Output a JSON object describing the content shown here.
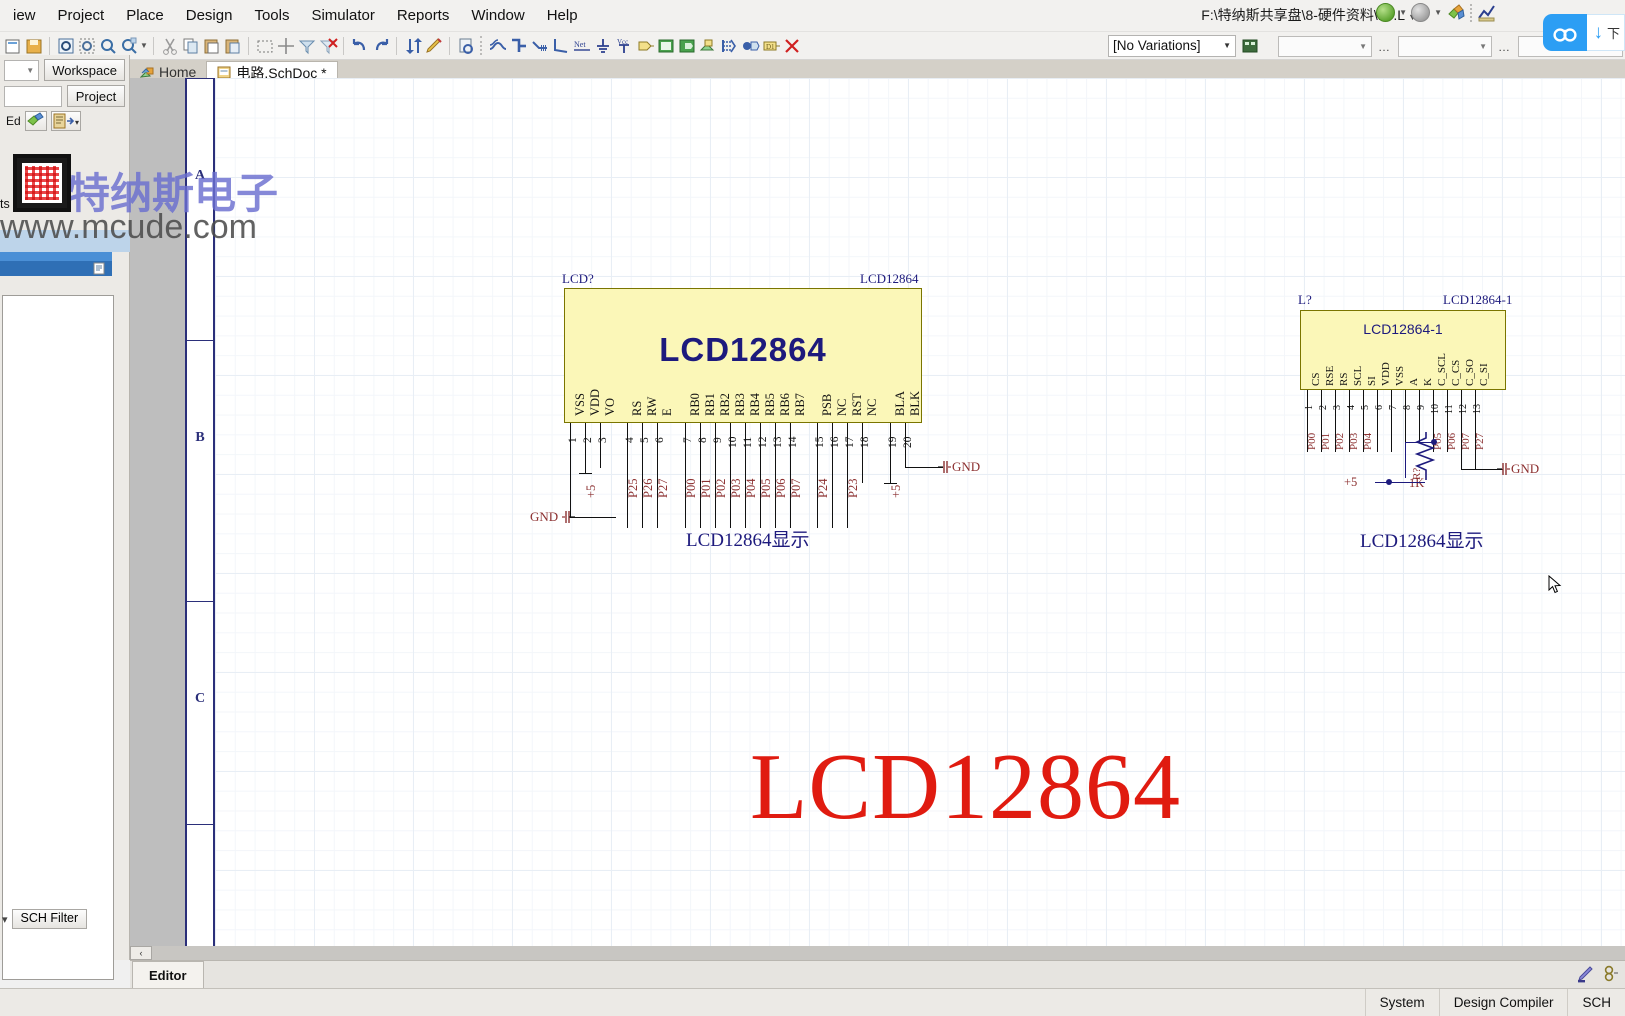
{
  "app": {
    "menu": [
      "iew",
      "Project",
      "Place",
      "Design",
      "Tools",
      "Simulator",
      "Reports",
      "Window",
      "Help"
    ],
    "document_path": "F:\\特纳斯共享盘\\8-硬件资料\\10.L",
    "variations": "[No Variations]"
  },
  "tabs": [
    {
      "label": "Home",
      "icon": "home-icon",
      "active": false
    },
    {
      "label": "电路.SchDoc *",
      "icon": "schematic-doc-icon",
      "active": true
    }
  ],
  "left_panel": {
    "workspace_button": "Workspace",
    "project_button": "Project",
    "editor_label": "Ed",
    "components_label": "ts",
    "filter_button": "SCH Filter"
  },
  "ruler": {
    "zones": [
      "A",
      "B",
      "C"
    ]
  },
  "download_widget": {
    "label": "下",
    "arrow": "↓"
  },
  "watermark": {
    "chinese": "特纳斯电子",
    "url": "www.mcude.com"
  },
  "editor": {
    "bottom_tab": "Editor",
    "scroll_left": "‹"
  },
  "statusbar": {
    "items": [
      "System",
      "Design Compiler",
      "SCH"
    ]
  },
  "schematic": {
    "big_red_text": "LCD12864",
    "components": [
      {
        "designator": "LCD?",
        "part_number": "LCD12864",
        "body_label": "LCD12864",
        "caption": "LCD12864显示",
        "pins": [
          {
            "num": "1",
            "name": "VSS",
            "net": ""
          },
          {
            "num": "2",
            "name": "VDD",
            "net": "+5"
          },
          {
            "num": "3",
            "name": "VO",
            "net": ""
          },
          {
            "num": "4",
            "name": "RS",
            "net": "P25"
          },
          {
            "num": "5",
            "name": "RW",
            "net": "P26"
          },
          {
            "num": "6",
            "name": "E",
            "net": "P27"
          },
          {
            "num": "7",
            "name": "RB0",
            "net": "P00"
          },
          {
            "num": "8",
            "name": "RB1",
            "net": "P01"
          },
          {
            "num": "9",
            "name": "RB2",
            "net": "P02"
          },
          {
            "num": "10",
            "name": "RB3",
            "net": "P03"
          },
          {
            "num": "11",
            "name": "RB4",
            "net": "P04"
          },
          {
            "num": "12",
            "name": "RB5",
            "net": "P05"
          },
          {
            "num": "13",
            "name": "RB6",
            "net": "P06"
          },
          {
            "num": "14",
            "name": "RB7",
            "net": "P07"
          },
          {
            "num": "15",
            "name": "PSB",
            "net": "P24"
          },
          {
            "num": "16",
            "name": "NC",
            "net": ""
          },
          {
            "num": "17",
            "name": "RST",
            "net": "P23"
          },
          {
            "num": "18",
            "name": "NC",
            "net": ""
          },
          {
            "num": "19",
            "name": "BLA",
            "net": "+5"
          },
          {
            "num": "20",
            "name": "BLK",
            "net": ""
          }
        ],
        "power_ports": [
          {
            "label": "GND",
            "type": "gnd"
          },
          {
            "label": "GND",
            "type": "gnd"
          }
        ]
      },
      {
        "designator": "L?",
        "part_number": "LCD12864-1",
        "body_label": "LCD12864-1",
        "caption": "LCD12864显示",
        "pins": [
          {
            "num": "1",
            "name": "CS",
            "net": "P00"
          },
          {
            "num": "2",
            "name": "RSE",
            "net": "P01"
          },
          {
            "num": "3",
            "name": "RS",
            "net": "P02"
          },
          {
            "num": "4",
            "name": "SCL",
            "net": "P03"
          },
          {
            "num": "5",
            "name": "SI",
            "net": "P04"
          },
          {
            "num": "6",
            "name": "VDD",
            "net": ""
          },
          {
            "num": "7",
            "name": "VSS",
            "net": ""
          },
          {
            "num": "8",
            "name": "A",
            "net": ""
          },
          {
            "num": "9",
            "name": "K",
            "net": ""
          },
          {
            "num": "10",
            "name": "C_SCL",
            "net": "P05"
          },
          {
            "num": "11",
            "name": "C_CS",
            "net": "P06"
          },
          {
            "num": "12",
            "name": "C_SO",
            "net": "P07"
          },
          {
            "num": "13",
            "name": "C_SI",
            "net": "P27"
          }
        ],
        "resistor": {
          "designator": "R?",
          "value": "1K"
        },
        "power_ports": [
          {
            "label": "+5",
            "type": "rail"
          },
          {
            "label": "GND",
            "type": "gnd"
          }
        ]
      }
    ]
  },
  "colors": {
    "component_fill": "#fbf7b8",
    "component_border": "#7a7500",
    "wire": "#1d1a7d",
    "net_label": "#8c3030",
    "big_text": "#e01b10",
    "accent_blue": "#2c9ef4"
  }
}
